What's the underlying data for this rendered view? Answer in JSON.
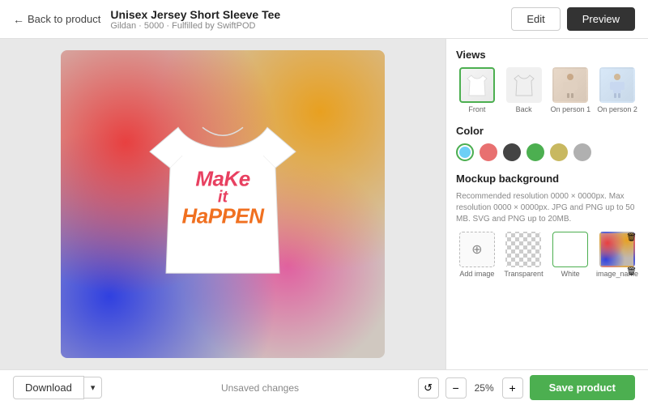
{
  "header": {
    "back_label": "Back to product",
    "product_title": "Unisex Jersey Short Sleeve Tee",
    "product_sub": "Gildan · 5000 · Fulfilled by SwiftPOD",
    "btn_edit": "Edit",
    "btn_preview": "Preview"
  },
  "views": {
    "section_title": "Views",
    "items": [
      {
        "label": "Front",
        "active": true
      },
      {
        "label": "Back",
        "active": false
      },
      {
        "label": "On person 1",
        "active": false
      },
      {
        "label": "On person 2",
        "active": false
      }
    ]
  },
  "color": {
    "section_title": "Color",
    "swatches": [
      {
        "hex": "#6dcff6",
        "active": true
      },
      {
        "hex": "#e87070",
        "active": false
      },
      {
        "hex": "#444444",
        "active": false
      },
      {
        "hex": "#4caf50",
        "active": false
      },
      {
        "hex": "#c8b860",
        "active": false
      },
      {
        "hex": "#b0b0b0",
        "active": false
      }
    ]
  },
  "mockup_background": {
    "section_title": "Mockup background",
    "description": "Recommended resolution 0000 × 0000px. Max resolution 0000 × 0000px. JPG and PNG up to 50 MB. SVG and PNG up to 20MB.",
    "add_image_label": "Add image",
    "options": [
      {
        "label": "Transparent",
        "type": "transparent"
      },
      {
        "label": "White",
        "type": "white",
        "active": true
      },
      {
        "label": "image_name",
        "type": "gradient"
      }
    ]
  },
  "canvas": {
    "text_line1": "MaKe",
    "text_line2": "it",
    "text_line3": "HaPPEN"
  },
  "footer": {
    "download_label": "Download",
    "unsaved_changes": "Unsaved changes",
    "zoom_value": "25%",
    "zoom_minus": "−",
    "zoom_plus": "+",
    "save_label": "Save product"
  }
}
